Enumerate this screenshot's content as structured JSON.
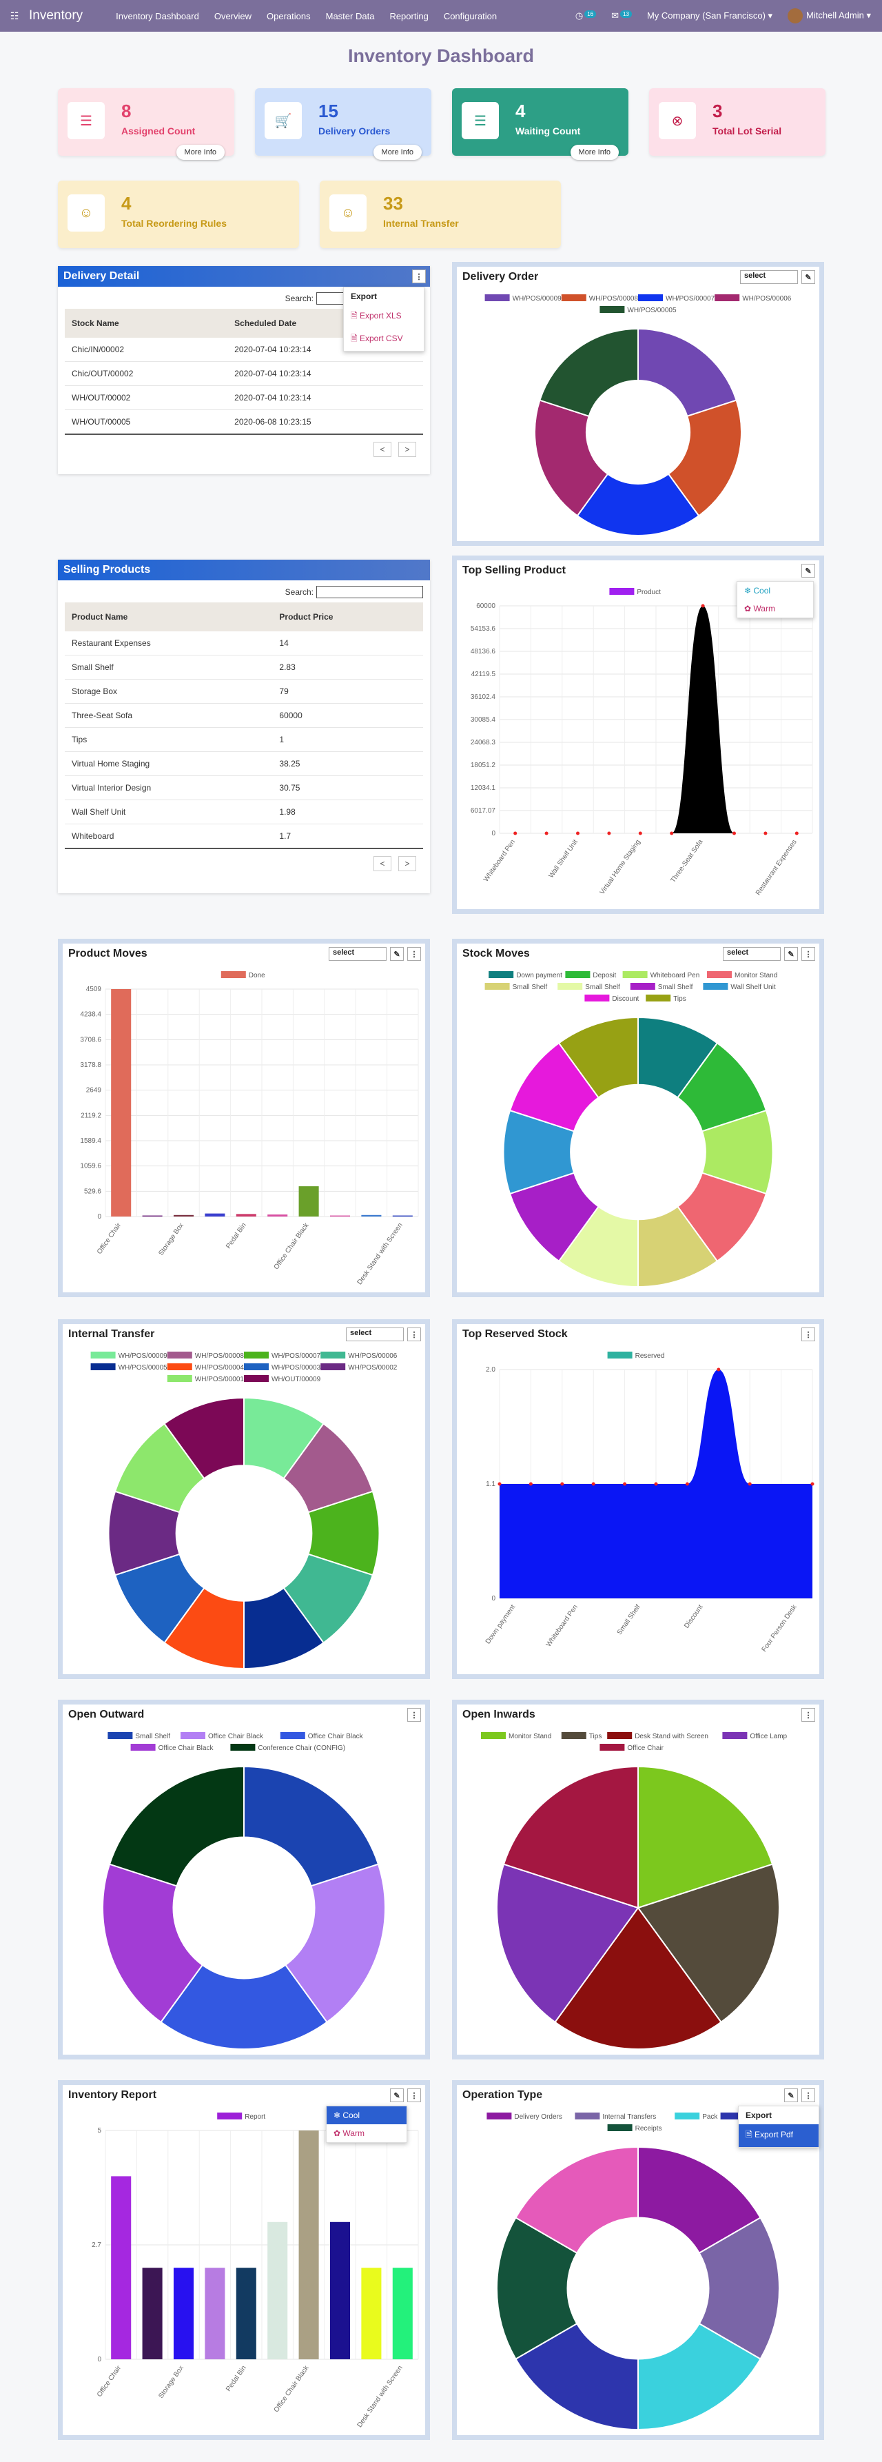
{
  "nav": {
    "brand": "Inventory",
    "menu": [
      "Inventory Dashboard",
      "Overview",
      "Operations",
      "Master Data",
      "Reporting",
      "Configuration"
    ],
    "activity_count": "16",
    "message_count": "13",
    "company": "My Company (San Francisco)",
    "user": "Mitchell Admin"
  },
  "page_title": "Inventory Dashboard",
  "cards": [
    {
      "value": "8",
      "label": "Assigned Count",
      "more": "More Info",
      "color": "#e2426c"
    },
    {
      "value": "15",
      "label": "Delivery Orders",
      "more": "More Info",
      "color": "#2a59d1"
    },
    {
      "value": "4",
      "label": "Waiting Count",
      "more": "More Info",
      "color": "#ffffff"
    },
    {
      "value": "3",
      "label": "Total Lot Serial",
      "color": "#c21d4a"
    },
    {
      "value": "4",
      "label": "Total Reordering Rules",
      "color": "#c79a18"
    },
    {
      "value": "33",
      "label": "Internal Transfer",
      "color": "#c79a18"
    }
  ],
  "delivery_detail": {
    "title": "Delivery Detail",
    "search_label": "Search:",
    "columns": [
      "Stock Name",
      "Scheduled Date"
    ],
    "rows": [
      [
        "Chic/IN/00002",
        "2020-07-04 10:23:14"
      ],
      [
        "Chic/OUT/00002",
        "2020-07-04 10:23:14"
      ],
      [
        "WH/OUT/00002",
        "2020-07-04 10:23:14"
      ],
      [
        "WH/OUT/00005",
        "2020-06-08 10:23:15"
      ]
    ],
    "pager_prev": "<",
    "pager_next": ">",
    "export_menu": {
      "heading": "Export",
      "items": [
        "Export XLS",
        "Export CSV"
      ]
    }
  },
  "selling_products": {
    "title": "Selling Products",
    "search_label": "Search:",
    "columns": [
      "Product Name",
      "Product Price"
    ],
    "rows": [
      [
        "Restaurant Expenses",
        "14"
      ],
      [
        "Small Shelf",
        "2.83"
      ],
      [
        "Storage Box",
        "79"
      ],
      [
        "Three-Seat Sofa",
        "60000"
      ],
      [
        "Tips",
        "1"
      ],
      [
        "Virtual Home Staging",
        "38.25"
      ],
      [
        "Virtual Interior Design",
        "30.75"
      ],
      [
        "Wall Shelf Unit",
        "1.98"
      ],
      [
        "Whiteboard",
        "1.7"
      ]
    ],
    "pager_prev": "<",
    "pager_next": ">"
  },
  "panels": {
    "delivery_order": {
      "title": "Delivery Order",
      "select": "select"
    },
    "top_selling": {
      "title": "Top Selling Product",
      "menu": [
        "Cool",
        "Warm"
      ]
    },
    "product_moves": {
      "title": "Product Moves",
      "select": "select"
    },
    "stock_moves": {
      "title": "Stock Moves",
      "select": "select"
    },
    "internal_transfer": {
      "title": "Internal Transfer",
      "select": "select"
    },
    "top_reserved": {
      "title": "Top Reserved Stock"
    },
    "open_outward": {
      "title": "Open Outward"
    },
    "open_inwards": {
      "title": "Open Inwards"
    },
    "inventory_report": {
      "title": "Inventory Report",
      "menu": [
        "Cool",
        "Warm"
      ]
    },
    "operation_type": {
      "title": "Operation Type",
      "menu_heading": "Export",
      "menu": [
        "Export Pdf"
      ]
    }
  },
  "chart_data": [
    {
      "id": "delivery_order",
      "type": "pie",
      "labels": [
        "WH/POS/00009",
        "WH/POS/00008",
        "WH/POS/00007",
        "WH/POS/00006",
        "WH/POS/00005"
      ],
      "values": [
        1,
        1,
        1,
        1,
        1
      ],
      "colors": [
        "#7048b2",
        "#d0512a",
        "#1035ef",
        "#a3296f",
        "#225430"
      ],
      "legend": "top"
    },
    {
      "id": "top_selling",
      "type": "line",
      "series": [
        {
          "name": "Product",
          "color": "#a020f0"
        }
      ],
      "categories": [
        "Whiteboard Pen",
        "",
        "Wall Shelf Unit",
        "",
        "Virtual Home Staging",
        "",
        "Three-Seat Sofa",
        "",
        "",
        "Restaurant Expenses"
      ],
      "values": [
        0,
        0,
        0,
        0,
        0,
        0,
        60000,
        0,
        0,
        0
      ],
      "yticks": [
        "0",
        "6017.07",
        "12034.1",
        "18051.2",
        "24068.3",
        "30085.4",
        "36102.4",
        "42119.5",
        "48136.6",
        "54153.6",
        "60000"
      ],
      "ylim": [
        0,
        60000
      ]
    },
    {
      "id": "product_moves",
      "type": "bar",
      "series": [
        {
          "name": "Done",
          "color": "#e06b5a"
        }
      ],
      "categories": [
        "Office Chair",
        "",
        "Storage Box",
        "",
        "Pedal Bin",
        "",
        "Office Chair Black",
        "",
        "",
        "Desk Stand with Screen"
      ],
      "values": [
        4509,
        20,
        30,
        60,
        50,
        40,
        600,
        20,
        30,
        20
      ],
      "bar_colors": [
        "#e06b5a",
        "#6a1f7a",
        "#7a2f3f",
        "#3a3fcf",
        "#cc3a6a",
        "#d84fa2",
        "#6aa02a",
        "#d84fa2",
        "#3a7acf",
        "#2a3fbf"
      ],
      "yticks": [
        "0",
        "529.6",
        "1059.6",
        "1589.4",
        "2119.2",
        "2649",
        "3178.8",
        "3708.6",
        "4238.4",
        "4509"
      ],
      "ylim": [
        0,
        4509
      ]
    },
    {
      "id": "stock_moves",
      "type": "pie",
      "labels": [
        "Down payment",
        "Deposit",
        "Whiteboard Pen",
        "Monitor Stand",
        "Small Shelf",
        "Small Shelf",
        "Small Shelf",
        "Wall Shelf Unit",
        "Discount",
        "Tips"
      ],
      "values": [
        1,
        1,
        1,
        1,
        1,
        1,
        1,
        1,
        1,
        1
      ],
      "colors": [
        "#0e7f7f",
        "#2eba38",
        "#acea62",
        "#ef6671",
        "#d7d274",
        "#e4f9a6",
        "#a71fc7",
        "#3097d2",
        "#e619dc",
        "#97a114"
      ],
      "legend": "top"
    },
    {
      "id": "internal_transfer",
      "type": "pie",
      "labels": [
        "WH/POS/00009",
        "WH/POS/00008",
        "WH/POS/00007",
        "WH/POS/00006",
        "WH/POS/00005",
        "WH/POS/00004",
        "WH/POS/00003",
        "WH/POS/00002",
        "WH/POS/00001",
        "WH/OUT/00009"
      ],
      "values": [
        1,
        1,
        1,
        1,
        1,
        1,
        1,
        1,
        1,
        1
      ],
      "colors": [
        "#78ea98",
        "#a35a8d",
        "#4cb31d",
        "#40b892",
        "#072d91",
        "#fc4b13",
        "#1e62c1",
        "#6b2a84",
        "#8de76c",
        "#7c0856"
      ],
      "legend": "top"
    },
    {
      "id": "top_reserved",
      "type": "area",
      "series": [
        {
          "name": "Reserved",
          "color": "#2fb2a0"
        }
      ],
      "categories": [
        "Down payment",
        "",
        "Whiteboard Pen",
        "",
        "Small Shelf",
        "",
        "Discount",
        "",
        "",
        "Four Person Desk"
      ],
      "values": [
        1,
        1,
        1,
        1,
        1,
        1,
        1,
        2,
        1,
        1
      ],
      "yticks": [
        "0",
        "1.1",
        "2.0"
      ],
      "ylim": [
        0,
        2
      ]
    },
    {
      "id": "open_outward",
      "type": "pie",
      "labels": [
        "Small Shelf",
        "Office Chair Black",
        "Office Chair Black",
        "Office Chair Black",
        "Conference Chair (CONFIG)"
      ],
      "values": [
        1,
        1,
        1,
        1,
        1
      ],
      "colors": [
        "#1b44b1",
        "#b27ff4",
        "#3358e1",
        "#a23cd5",
        "#033814"
      ],
      "legend": "top"
    },
    {
      "id": "open_inwards",
      "type": "pie",
      "labels": [
        "Monitor Stand",
        "Tips",
        "Desk Stand with Screen",
        "Office Lamp",
        "Office Chair"
      ],
      "values": [
        1,
        1,
        1,
        1,
        1
      ],
      "colors": [
        "#7cc81e",
        "#544b3b",
        "#8b0f0e",
        "#7b34b5",
        "#a41741"
      ],
      "legend": "top",
      "donut": false
    },
    {
      "id": "inventory_report",
      "type": "bar",
      "series": [
        {
          "name": "Report",
          "color": "#9d20d8"
        }
      ],
      "categories": [
        "Office Chair",
        "",
        "Storage Box",
        "",
        "Pedal Bin",
        "",
        "Office Chair Black",
        "",
        "",
        "Desk Stand with Screen"
      ],
      "values": [
        4,
        2,
        2,
        2,
        2,
        3,
        5,
        3,
        2,
        2
      ],
      "bar_colors": [
        "#a528e0",
        "#3c1654",
        "#2811f0",
        "#b77ce2",
        "#123a61",
        "#d9e9e0",
        "#aaa084",
        "#1b1190",
        "#e9fb1d",
        "#23f17b"
      ],
      "yticks": [
        "0",
        "2.7",
        "5"
      ],
      "ylim": [
        0,
        5
      ]
    },
    {
      "id": "operation_type",
      "type": "pie",
      "labels": [
        "Delivery Orders",
        "Internal Transfers",
        "Pack",
        "PoS Orders",
        "Receipts"
      ],
      "values": [
        1,
        1,
        1,
        1,
        1
      ],
      "colors": [
        "#8d1aa1",
        "#7a65a7",
        "#3ad1dd",
        "#2d35ad",
        "#14533b"
      ],
      "extra_color": "#e55aba",
      "legend": "top"
    }
  ]
}
